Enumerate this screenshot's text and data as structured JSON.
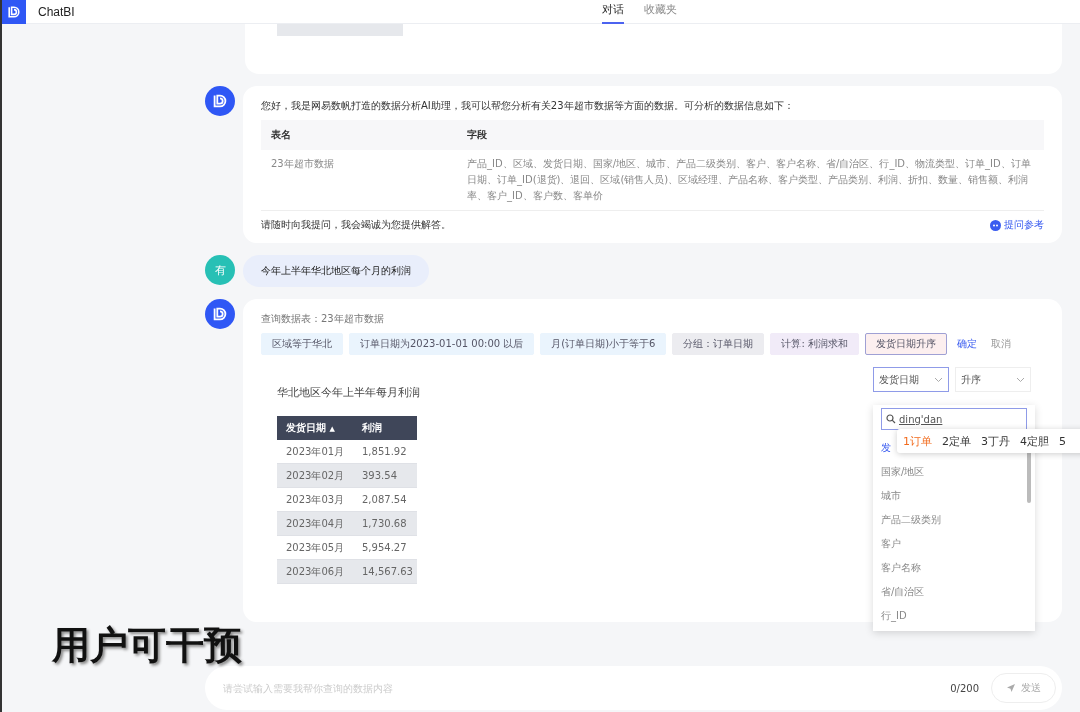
{
  "header": {
    "app_name": "ChatBI",
    "tabs": [
      {
        "label": "对话",
        "selected": true
      },
      {
        "label": "收藏夹",
        "selected": false
      }
    ]
  },
  "intro_message": {
    "greeting": "您好，我是网易数帆打造的数据分析AI助理，我可以帮您分析有关23年超市数据等方面的数据。可分析的数据信息如下：",
    "table": {
      "columns": [
        "表名",
        "字段"
      ],
      "rows": [
        {
          "table_name": "23年超市数据",
          "fields": "产品_ID、区域、发货日期、国家/地区、城市、产品二级类别、客户、客户名称、省/自治区、行_ID、物流类型、订单_ID、订单日期、订单_ID(退货)、退回、区域(销售人员)、区域经理、产品名称、客户类型、产品类别、利润、折扣、数量、销售额、利润率、客户_ID、客户数、客单价"
        }
      ]
    },
    "closing": "请随时向我提问，我会竭诚为您提供解答。",
    "reference_link": "提问参考"
  },
  "user_message": {
    "avatar": "有",
    "text": "今年上半年华北地区每个月的利润"
  },
  "answer": {
    "source": "查询数据表：23年超市数据",
    "chips": [
      {
        "label": "区域等于华北",
        "color": "#eaf4fd",
        "selected": false
      },
      {
        "label": "订单日期为2023-01-01 00:00 以后",
        "color": "#eaf4fd",
        "selected": false
      },
      {
        "label": "月(订单日期)小于等于6",
        "color": "#eaf4fd",
        "selected": false
      },
      {
        "label": "分组：订单日期",
        "color": "#ececf0",
        "selected": false
      },
      {
        "label": "计算: 利润求和",
        "color": "#f1ebf8",
        "selected": false
      },
      {
        "label": "发货日期升序",
        "color": "#fcefef",
        "selected": true
      }
    ],
    "confirm": "确定",
    "cancel": "取消",
    "result_title": "华北地区今年上半年每月利润",
    "table": {
      "columns": [
        "发货日期",
        "利润"
      ],
      "sort_arrow": "▲",
      "rows": [
        [
          "2023年01月",
          "1,851.92"
        ],
        [
          "2023年02月",
          "393.54"
        ],
        [
          "2023年03月",
          "2,087.54"
        ],
        [
          "2023年04月",
          "1,730.68"
        ],
        [
          "2023年05月",
          "5,954.27"
        ],
        [
          "2023年06月",
          "14,567.63"
        ]
      ]
    },
    "sort_field_select": {
      "value": "发货日期"
    },
    "sort_order_select": {
      "value": "升序"
    },
    "dropdown": {
      "search_value": "ding'dan",
      "items": [
        {
          "label": "发",
          "selected": true
        },
        {
          "label": "国家/地区",
          "selected": false
        },
        {
          "label": "城市",
          "selected": false
        },
        {
          "label": "产品二级类别",
          "selected": false
        },
        {
          "label": "客户",
          "selected": false
        },
        {
          "label": "客户名称",
          "selected": false
        },
        {
          "label": "省/自治区",
          "selected": false
        },
        {
          "label": "行_ID",
          "selected": false
        }
      ]
    },
    "ime_candidates": [
      {
        "label": "1订单",
        "selected": true
      },
      {
        "label": "2定单",
        "selected": false
      },
      {
        "label": "3丁丹",
        "selected": false
      },
      {
        "label": "4定胆",
        "selected": false
      },
      {
        "label": "5",
        "selected": false
      }
    ]
  },
  "caption": "用户可干预",
  "input_bar": {
    "placeholder": "请尝试输入需要我帮你查询的数据内容",
    "counter": "0/200",
    "send": "发送"
  }
}
